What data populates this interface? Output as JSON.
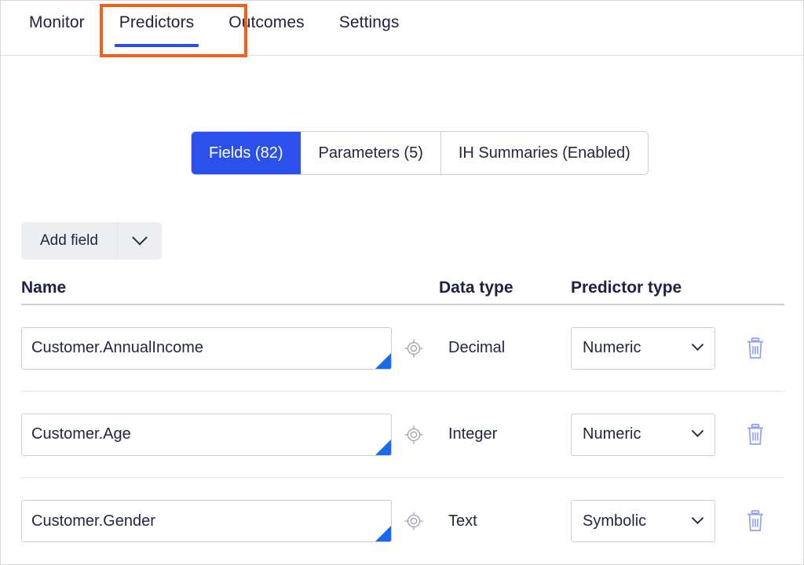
{
  "nav": {
    "tabs": [
      {
        "label": "Monitor",
        "active": false
      },
      {
        "label": "Predictors",
        "active": true
      },
      {
        "label": "Outcomes",
        "active": false
      },
      {
        "label": "Settings",
        "active": false
      }
    ],
    "active_underline_color": "#2a4dea",
    "annotation_color": "#f4601a"
  },
  "segmented_control": {
    "options": [
      {
        "label": "Fields (82)",
        "active": true
      },
      {
        "label": "Parameters (5)",
        "active": false
      },
      {
        "label": "IH Summaries (Enabled)",
        "active": false
      }
    ],
    "active_color": "#2c50ec"
  },
  "toolbar": {
    "add_field_label": "Add field",
    "caret_icon": "chevron-down-icon"
  },
  "table": {
    "headers": {
      "name": "Name",
      "data_type": "Data type",
      "predictor_type": "Predictor type"
    },
    "rows": [
      {
        "name": "Customer.AnnualIncome",
        "data_type": "Decimal",
        "predictor_type": "Numeric",
        "name_icon": "target-icon",
        "delete_icon": "trash-icon"
      },
      {
        "name": "Customer.Age",
        "data_type": "Integer",
        "predictor_type": "Numeric",
        "name_icon": "target-icon",
        "delete_icon": "trash-icon"
      },
      {
        "name": "Customer.Gender",
        "data_type": "Text",
        "predictor_type": "Symbolic",
        "name_icon": "target-icon",
        "delete_icon": "trash-icon"
      }
    ],
    "input_corner_color": "#176aee",
    "trash_color": "#8fa0f5"
  }
}
